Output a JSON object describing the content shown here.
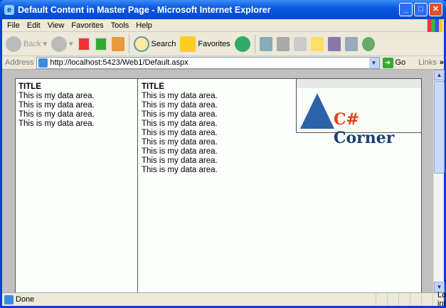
{
  "window": {
    "title": "Default Content in Master Page - Microsoft Internet Explorer"
  },
  "menu": [
    "File",
    "Edit",
    "View",
    "Favorites",
    "Tools",
    "Help"
  ],
  "toolbar": {
    "back": "Back",
    "search": "Search",
    "favorites": "Favorites"
  },
  "address": {
    "label": "Address",
    "url": "http://localhost:5423/Web1/Default.aspx",
    "go": "Go",
    "links": "Links"
  },
  "page": {
    "left": {
      "title": "TITLE",
      "lines": [
        "This is my data area.",
        "This is my data area.",
        "This is my data area.",
        "This is my data area."
      ]
    },
    "right": {
      "title": "TITLE",
      "lines": [
        "This is my data area.",
        "This is my data area.",
        "This is my data area.",
        "This is my data area.",
        "This is my data area.",
        "This is my data area.",
        "This is my data area.",
        "This is my data area.",
        "This is my data area."
      ]
    },
    "logo": {
      "text_a": "C#",
      "text_b": "Corner"
    }
  },
  "status": {
    "text": "Done",
    "zone": "Local intranet"
  }
}
